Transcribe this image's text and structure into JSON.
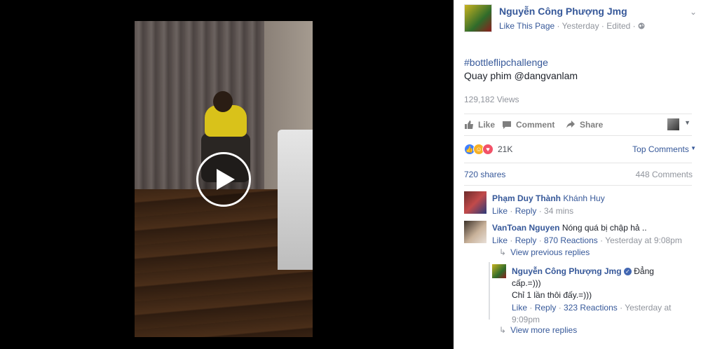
{
  "post": {
    "page_name": "Nguyễn Công Phượng Jmg",
    "like_page": "Like This Page",
    "time": "Yesterday",
    "edited": "Edited",
    "hashtag": "#bottleflipchallenge",
    "caption": "Quay phim @dangvanlam",
    "views": "129,182 Views"
  },
  "actions": {
    "like": "Like",
    "comment": "Comment",
    "share": "Share"
  },
  "reactions": {
    "count": "21K",
    "top_comments": "Top Comments"
  },
  "stats": {
    "shares": "720 shares",
    "comments": "448 Comments"
  },
  "comments": [
    {
      "author": "Phạm Duy Thành",
      "mention": "Khánh Huy",
      "text": "",
      "like": "Like",
      "reply": "Reply",
      "time": "34 mins",
      "reactions": ""
    },
    {
      "author": "VanToan Nguyen",
      "mention": "",
      "text": "Nóng quá bị chập hả ..",
      "like": "Like",
      "reply": "Reply",
      "time": "Yesterday at 9:08pm",
      "reactions": "870 Reactions"
    }
  ],
  "view_previous": "View previous replies",
  "reply": {
    "author": "Nguyễn Công Phượng Jmg",
    "text1": "Đẳng",
    "text2": "cấp.=)))",
    "text3": "Chỉ 1 lần thôi đấy.=)))",
    "like": "Like",
    "reply": "Reply",
    "reactions": "323 Reactions",
    "time1": "Yesterday at",
    "time2": "9:09pm"
  },
  "view_more": "View more replies",
  "colors": {
    "link": "#365899",
    "muted": "#90949c",
    "like_blue": "#4080ff",
    "haha_yellow": "#f7b125",
    "love_red": "#f25268"
  },
  "icons": [
    "play-icon",
    "globe-icon",
    "thumbs-up-icon",
    "comment-icon",
    "share-icon",
    "verified-icon",
    "reply-arrow-icon",
    "chevron-down-icon"
  ]
}
